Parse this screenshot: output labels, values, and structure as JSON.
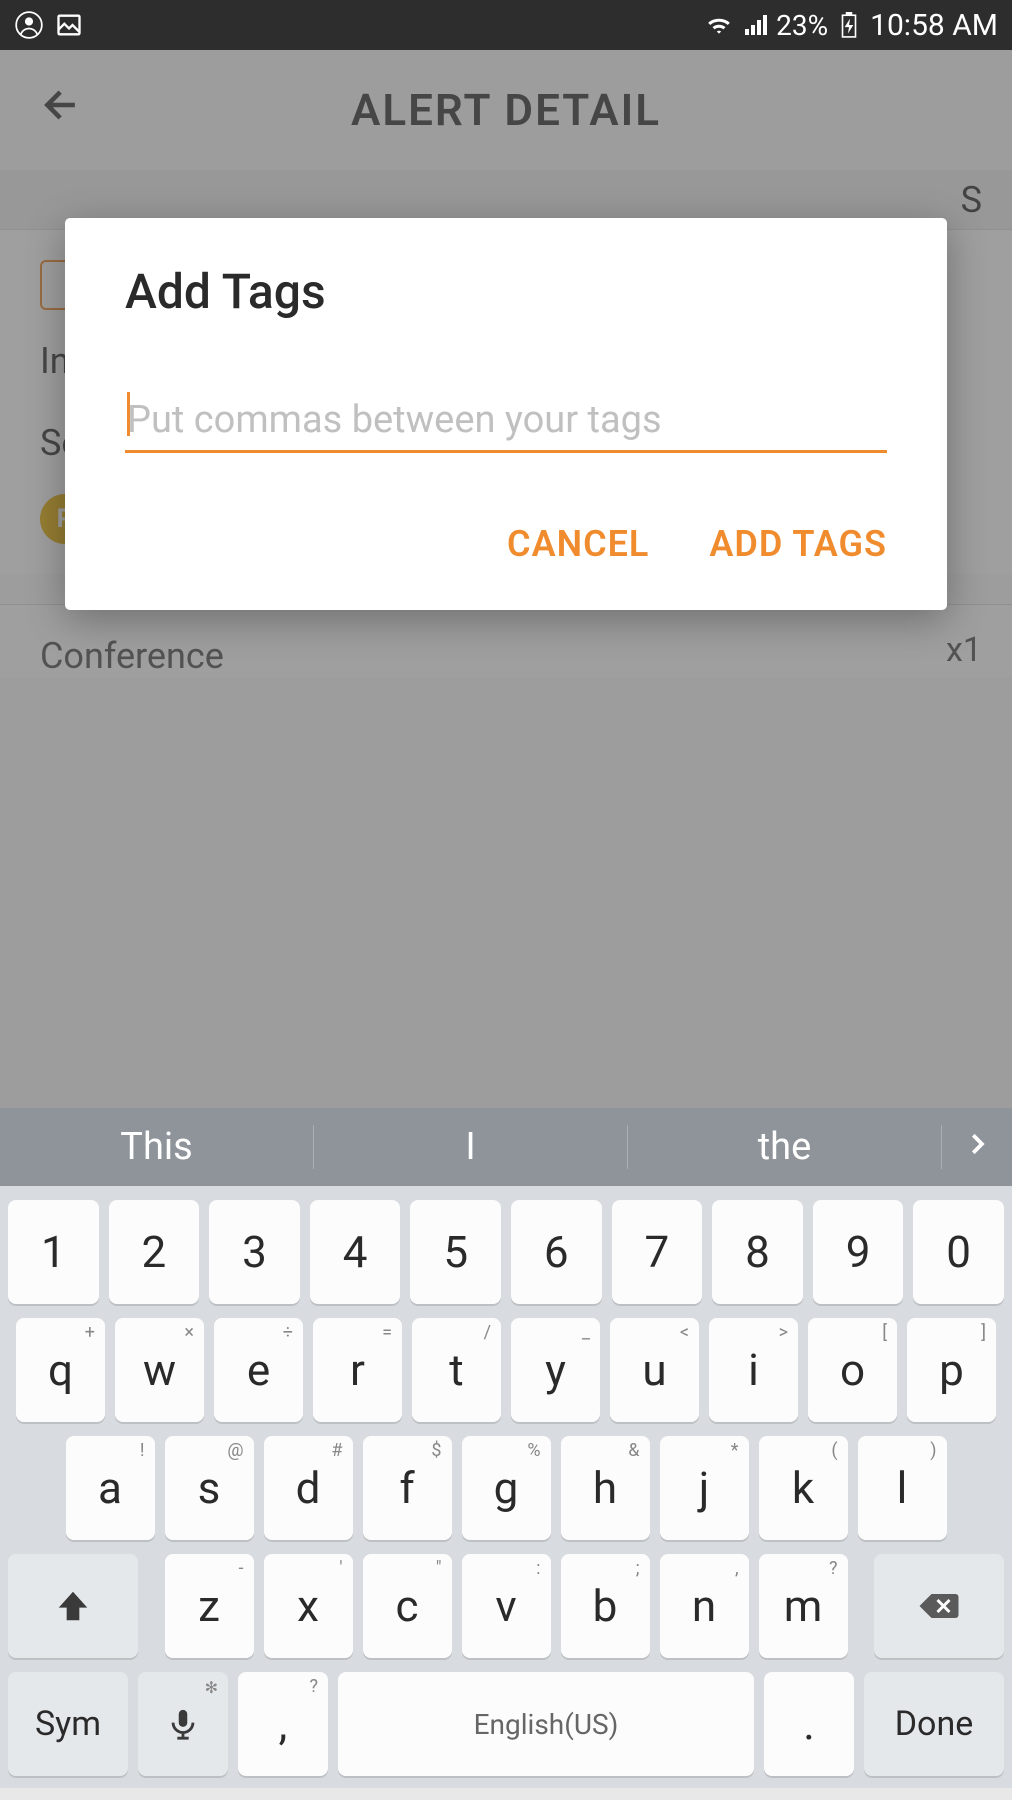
{
  "status_bar": {
    "battery": "23%",
    "time": "10:58 AM"
  },
  "header": {
    "title": "ALERT DETAIL"
  },
  "background": {
    "label_in": "In",
    "label_se": "Se",
    "badge_x1": "x1",
    "label_s": "S",
    "conference": "Conference"
  },
  "dialog": {
    "title": "Add Tags",
    "placeholder": "Put commas between your tags",
    "value": "",
    "cancel": "CANCEL",
    "confirm": "ADD TAGS"
  },
  "keyboard": {
    "suggestions": [
      "This",
      "I",
      "the"
    ],
    "row1": [
      "1",
      "2",
      "3",
      "4",
      "5",
      "6",
      "7",
      "8",
      "9",
      "0"
    ],
    "row2": [
      {
        "k": "q",
        "s": "+"
      },
      {
        "k": "w",
        "s": "×"
      },
      {
        "k": "e",
        "s": "÷"
      },
      {
        "k": "r",
        "s": "="
      },
      {
        "k": "t",
        "s": "/"
      },
      {
        "k": "y",
        "s": "_"
      },
      {
        "k": "u",
        "s": "<"
      },
      {
        "k": "i",
        "s": ">"
      },
      {
        "k": "o",
        "s": "["
      },
      {
        "k": "p",
        "s": "]"
      }
    ],
    "row3": [
      {
        "k": "a",
        "s": "!"
      },
      {
        "k": "s",
        "s": "@"
      },
      {
        "k": "d",
        "s": "#"
      },
      {
        "k": "f",
        "s": "$"
      },
      {
        "k": "g",
        "s": "%"
      },
      {
        "k": "h",
        "s": "&"
      },
      {
        "k": "j",
        "s": "*"
      },
      {
        "k": "k",
        "s": "("
      },
      {
        "k": "l",
        "s": ")"
      }
    ],
    "row4": [
      {
        "k": "z",
        "s": "-"
      },
      {
        "k": "x",
        "s": "'"
      },
      {
        "k": "c",
        "s": "\""
      },
      {
        "k": "v",
        "s": ":"
      },
      {
        "k": "b",
        "s": ";"
      },
      {
        "k": "n",
        "s": ","
      },
      {
        "k": "m",
        "s": "?"
      }
    ],
    "sym": "Sym",
    "comma_sup": "?",
    "comma": ",",
    "space": "English(US)",
    "period": ".",
    "done": "Done"
  }
}
